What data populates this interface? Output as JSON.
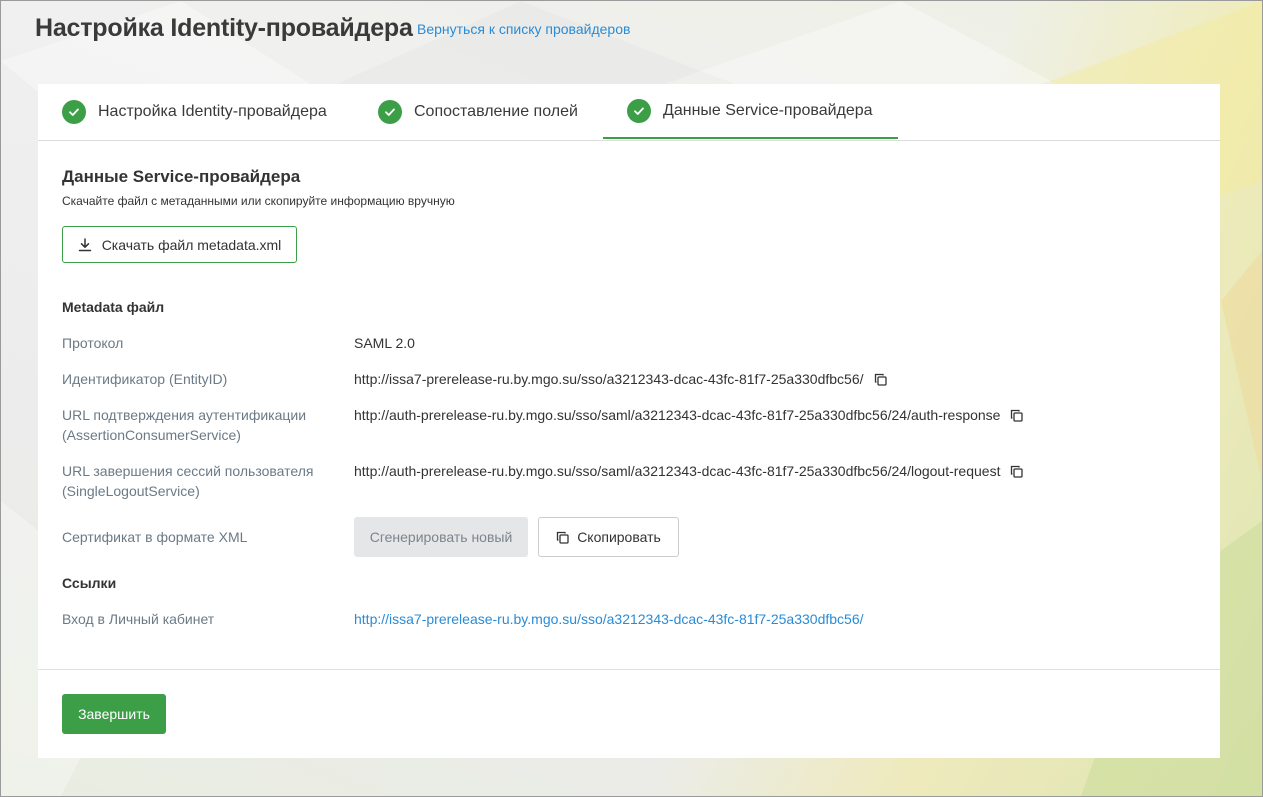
{
  "header": {
    "title": "Настройка Identity-провайдера",
    "back_link": "Вернуться к списку провайдеров"
  },
  "tabs": [
    {
      "label": "Настройка Identity-провайдера",
      "icon": "check-icon",
      "done": true,
      "active": false
    },
    {
      "label": "Сопоставление полей",
      "icon": "check-icon",
      "done": true,
      "active": false
    },
    {
      "label": "Данные Service-провайдера",
      "icon": "check-icon",
      "done": true,
      "active": true
    }
  ],
  "section": {
    "title": "Данные Service-провайдера",
    "subtitle": "Скачайте файл с метаданными или скопируйте информацию вручную",
    "download_button": "Скачать файл metadata.xml",
    "download_icon": "download-icon"
  },
  "metadata": {
    "group_title": "Metadata файл",
    "rows": [
      {
        "label": "Протокол",
        "value": "SAML 2.0"
      },
      {
        "label": "Идентификатор (EntityID)",
        "value": "http://issa7-prerelease-ru.by.mgo.su/sso/a3212343-dcac-43fc-81f7-25a330dfbc56/",
        "copy_icon": "copy-icon"
      },
      {
        "label": "URL подтверждения аутентификации (AssertionConsumerService)",
        "value": "http://auth-prerelease-ru.by.mgo.su/sso/saml/a3212343-dcac-43fc-81f7-25a330dfbc56/24/auth-response",
        "copy_icon": "copy-icon"
      },
      {
        "label": "URL завершения сессий пользователя (SingleLogoutService)",
        "value": "http://auth-prerelease-ru.by.mgo.su/sso/saml/a3212343-dcac-43fc-81f7-25a330dfbc56/24/logout-request",
        "copy_icon": "copy-icon"
      }
    ],
    "certificate": {
      "label": "Сертификат в формате XML",
      "generate_button": "Сгенерировать новый",
      "copy_button": "Скопировать"
    }
  },
  "links": {
    "group_title": "Ссылки",
    "login_label": "Вход в Личный кабинет",
    "login_url": "http://issa7-prerelease-ru.by.mgo.su/sso/a3212343-dcac-43fc-81f7-25a330dfbc56/"
  },
  "footer": {
    "finish_button": "Завершить"
  },
  "colors": {
    "accent_green": "#3c9e47",
    "link_blue": "#2a8bd6",
    "label_gray": "#6b7a86"
  }
}
